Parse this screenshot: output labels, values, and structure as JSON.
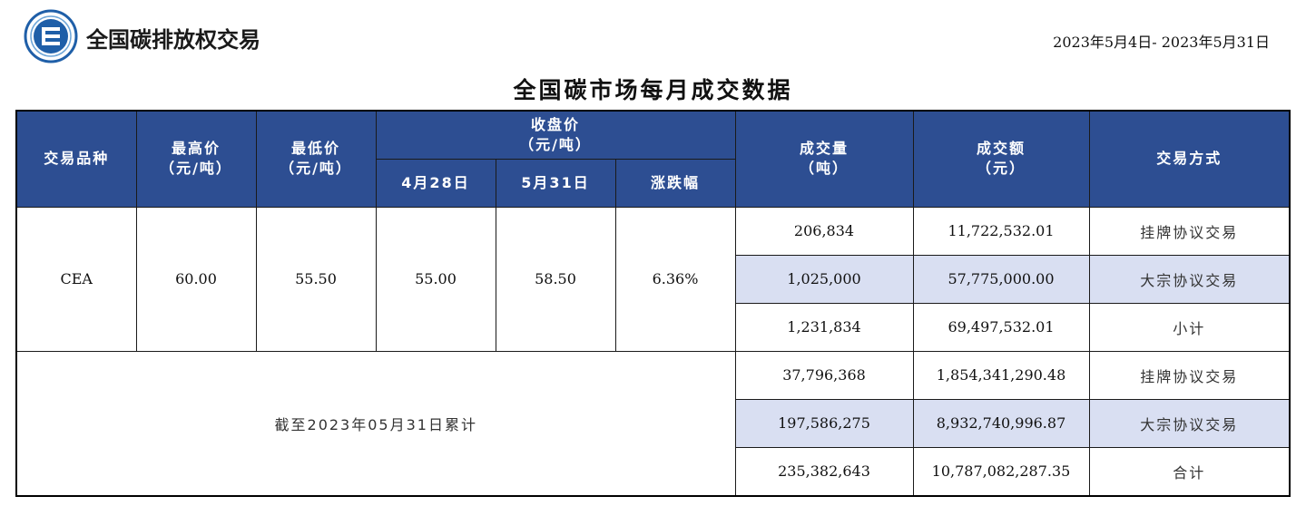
{
  "header": {
    "brand": "全国碳排放权交易",
    "date_range": "2023年5月4日- 2023年5月31日"
  },
  "title": "全国碳市场每月成交数据",
  "columns": {
    "variety": "交易品种",
    "high": [
      "最高价",
      "（元/吨）"
    ],
    "low": [
      "最低价",
      "（元/吨）"
    ],
    "close": [
      "收盘价",
      "（元/吨）"
    ],
    "close_sub": [
      "4月28日",
      "5月31日",
      "涨跌幅"
    ],
    "volume": [
      "成交量",
      "（吨）"
    ],
    "amount": [
      "成交额",
      "（元）"
    ],
    "method": "交易方式"
  },
  "cea": {
    "variety": "CEA",
    "high": "60.00",
    "low": "55.50",
    "close_prev": "55.00",
    "close_curr": "58.50",
    "change": "6.36%",
    "rows": [
      {
        "volume": "206,834",
        "amount": "11,722,532.01",
        "method": "挂牌协议交易"
      },
      {
        "volume": "1,025,000",
        "amount": "57,775,000.00",
        "method": "大宗协议交易"
      },
      {
        "volume": "1,231,834",
        "amount": "69,497,532.01",
        "method": "小计"
      }
    ]
  },
  "cumulative": {
    "label": "截至2023年05月31日累计",
    "rows": [
      {
        "volume": "37,796,368",
        "amount": "1,854,341,290.48",
        "method": "挂牌协议交易"
      },
      {
        "volume": "197,586,275",
        "amount": "8,932,740,996.87",
        "method": "大宗协议交易"
      },
      {
        "volume": "235,382,643",
        "amount": "10,787,082,287.35",
        "method": "合计"
      }
    ]
  },
  "colors": {
    "header_bg": "#2d4e92",
    "shade_bg": "#d9dff2",
    "logo_blue": "#1f5fa8"
  }
}
